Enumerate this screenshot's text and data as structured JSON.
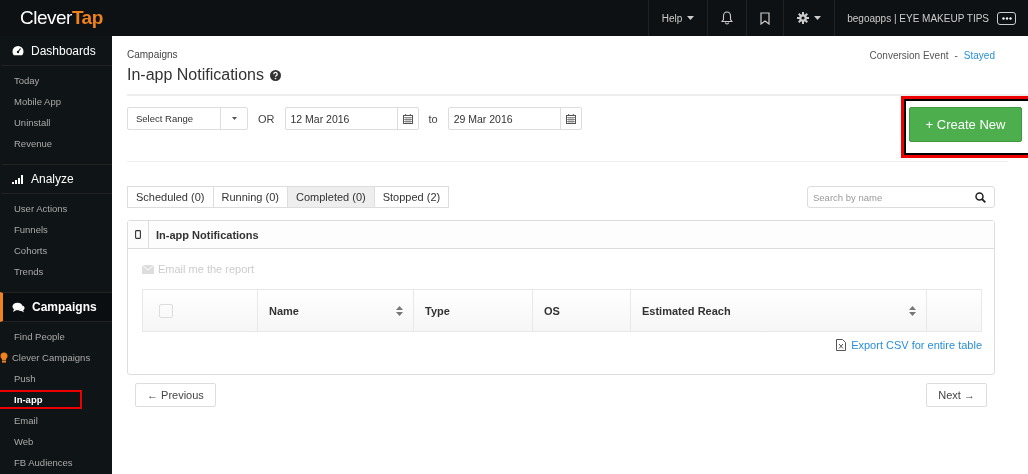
{
  "logo": {
    "parts": [
      "Clever",
      "Tap"
    ]
  },
  "topbar": {
    "help": "Help",
    "account": "begoapps | EYE MAKEUP TIPS"
  },
  "sidebar": {
    "sections": [
      {
        "title": "Dashboards",
        "active": false,
        "items": [
          {
            "label": "Today",
            "selected": false,
            "highlighted": false
          },
          {
            "label": "Mobile App",
            "selected": false,
            "highlighted": false
          },
          {
            "label": "Uninstall",
            "selected": false,
            "highlighted": false
          },
          {
            "label": "Revenue",
            "selected": false,
            "highlighted": false
          }
        ]
      },
      {
        "title": "Analyze",
        "active": false,
        "items": [
          {
            "label": "User Actions",
            "selected": false,
            "highlighted": false
          },
          {
            "label": "Funnels",
            "selected": false,
            "highlighted": false
          },
          {
            "label": "Cohorts",
            "selected": false,
            "highlighted": false
          },
          {
            "label": "Trends",
            "selected": false,
            "highlighted": false
          }
        ]
      },
      {
        "title": "Campaigns",
        "active": true,
        "items": [
          {
            "label": "Find People",
            "selected": false,
            "highlighted": false
          },
          {
            "label": "Clever Campaigns",
            "selected": false,
            "highlighted": false,
            "kind": "bulb"
          },
          {
            "label": "Push",
            "selected": false,
            "highlighted": false
          },
          {
            "label": "In-app",
            "selected": true,
            "highlighted": true
          },
          {
            "label": "Email",
            "selected": false,
            "highlighted": false
          },
          {
            "label": "Web",
            "selected": false,
            "highlighted": false
          },
          {
            "label": "FB Audiences",
            "selected": false,
            "highlighted": false
          }
        ]
      }
    ]
  },
  "breadcrumb": "Campaigns",
  "title": "In-app Notifications",
  "conversion": {
    "label": "Conversion Event",
    "separator": "-",
    "value": "Stayed"
  },
  "filter": {
    "range": "Select Range",
    "or": "OR",
    "from": "12 Mar 2016",
    "to_label": "to",
    "to": "29 Mar 2016"
  },
  "create_button": {
    "label": "+ Create New",
    "highlighted": true
  },
  "tabs": [
    {
      "label": "Scheduled (0)",
      "selected": false
    },
    {
      "label": "Running (0)",
      "selected": false
    },
    {
      "label": "Completed (0)",
      "selected": true
    },
    {
      "label": "Stopped (2)",
      "selected": false
    }
  ],
  "search": {
    "placeholder": "Search by name"
  },
  "panel": {
    "title": "In-app Notifications",
    "email_report": "Email me the report",
    "export": "Export CSV for entire table"
  },
  "table": {
    "select_all": {
      "checked": false
    },
    "columns": [
      {
        "label": "Name",
        "sortable": true
      },
      {
        "label": "Type",
        "sortable": false
      },
      {
        "label": "OS",
        "sortable": false
      },
      {
        "label": "Estimated Reach",
        "sortable": true
      }
    ]
  },
  "pager": {
    "previous": "← Previous",
    "next": "Next →"
  }
}
